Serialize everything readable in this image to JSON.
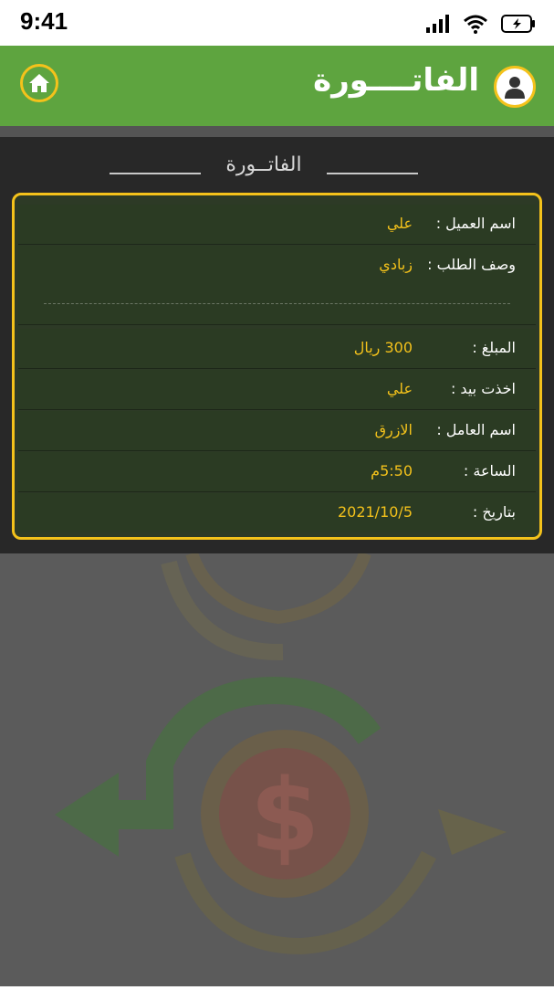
{
  "status_bar": {
    "time": "9:41"
  },
  "header": {
    "title": "الفاتــــورة"
  },
  "panel": {
    "title": "الفاتــورة"
  },
  "invoice": {
    "rows": [
      {
        "label": "اسم العميل :",
        "value": "علي"
      },
      {
        "label": "وصف الطلب :",
        "value": "زبادي"
      },
      {
        "label": "المبلغ :",
        "value": "300 ريال"
      },
      {
        "label": "اخذت بيد :",
        "value": "علي"
      },
      {
        "label": "اسم العامل :",
        "value": "الازرق"
      },
      {
        "label": "الساعة :",
        "value": "5:50م"
      },
      {
        "label": "بتاريخ :",
        "value": "2021/10/5"
      }
    ]
  },
  "colors": {
    "header": "#5ea43f",
    "accent": "#f4c21b",
    "panel": "#282828",
    "card": "#2b3b23"
  },
  "icons": {
    "home": "home-icon",
    "user": "user-icon",
    "signal": "signal-icon",
    "wifi": "wifi-icon",
    "battery": "battery-charging-icon"
  }
}
